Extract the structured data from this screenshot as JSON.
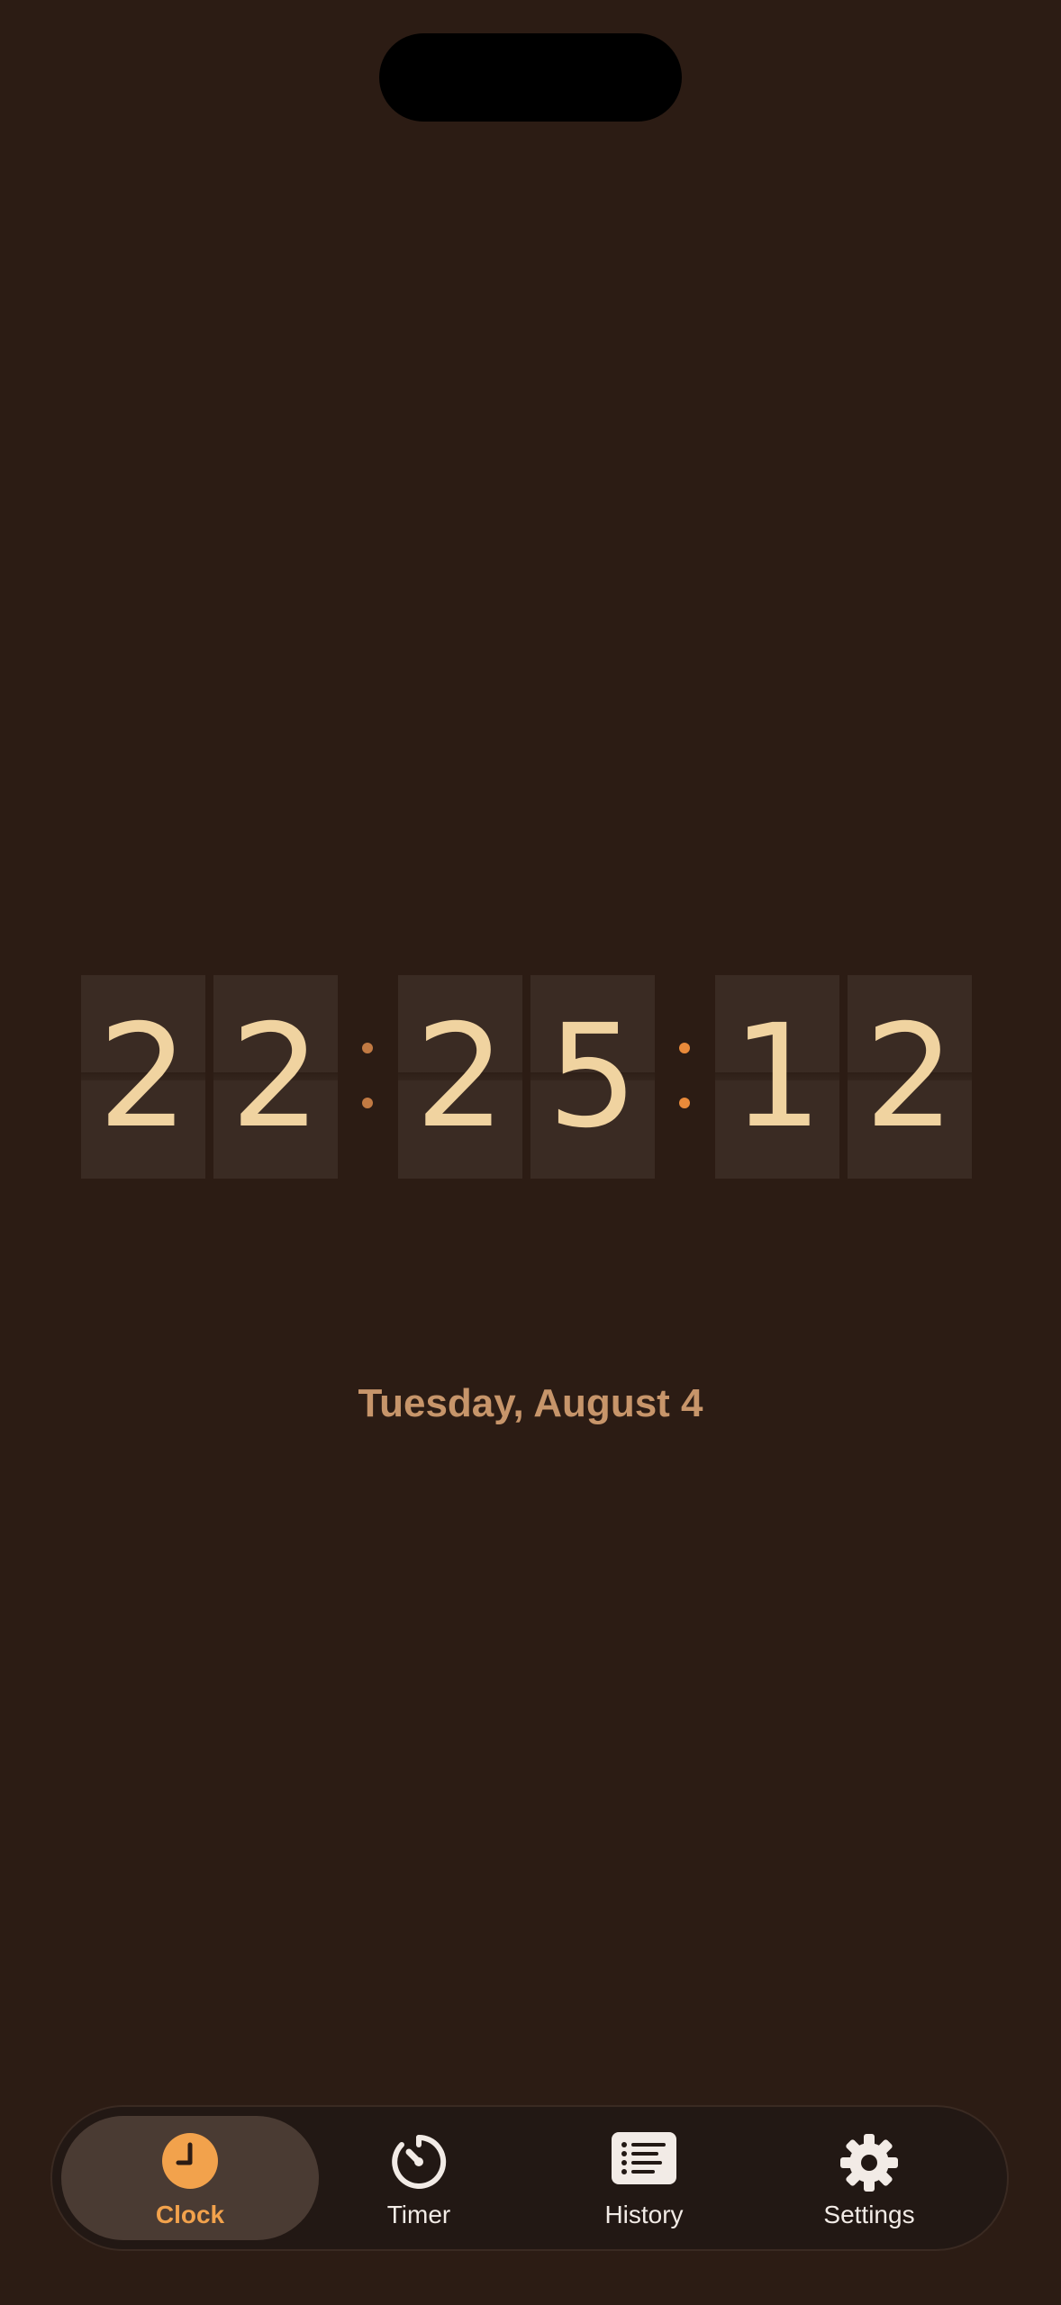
{
  "clock": {
    "digits": [
      "2",
      "2",
      "2",
      "5",
      "1",
      "2"
    ],
    "colon_color": "#e98a3a",
    "digit_color": "#f0d3a0"
  },
  "date": "Tuesday, August 4",
  "tabs": [
    {
      "label": "Clock",
      "icon": "clock-icon",
      "active": true
    },
    {
      "label": "Timer",
      "icon": "timer-icon",
      "active": false
    },
    {
      "label": "History",
      "icon": "list-icon",
      "active": false
    },
    {
      "label": "Settings",
      "icon": "gear-icon",
      "active": false
    }
  ],
  "colors": {
    "background": "#2c1c14",
    "accent": "#f2a24c",
    "tile": "#3a2b23"
  }
}
